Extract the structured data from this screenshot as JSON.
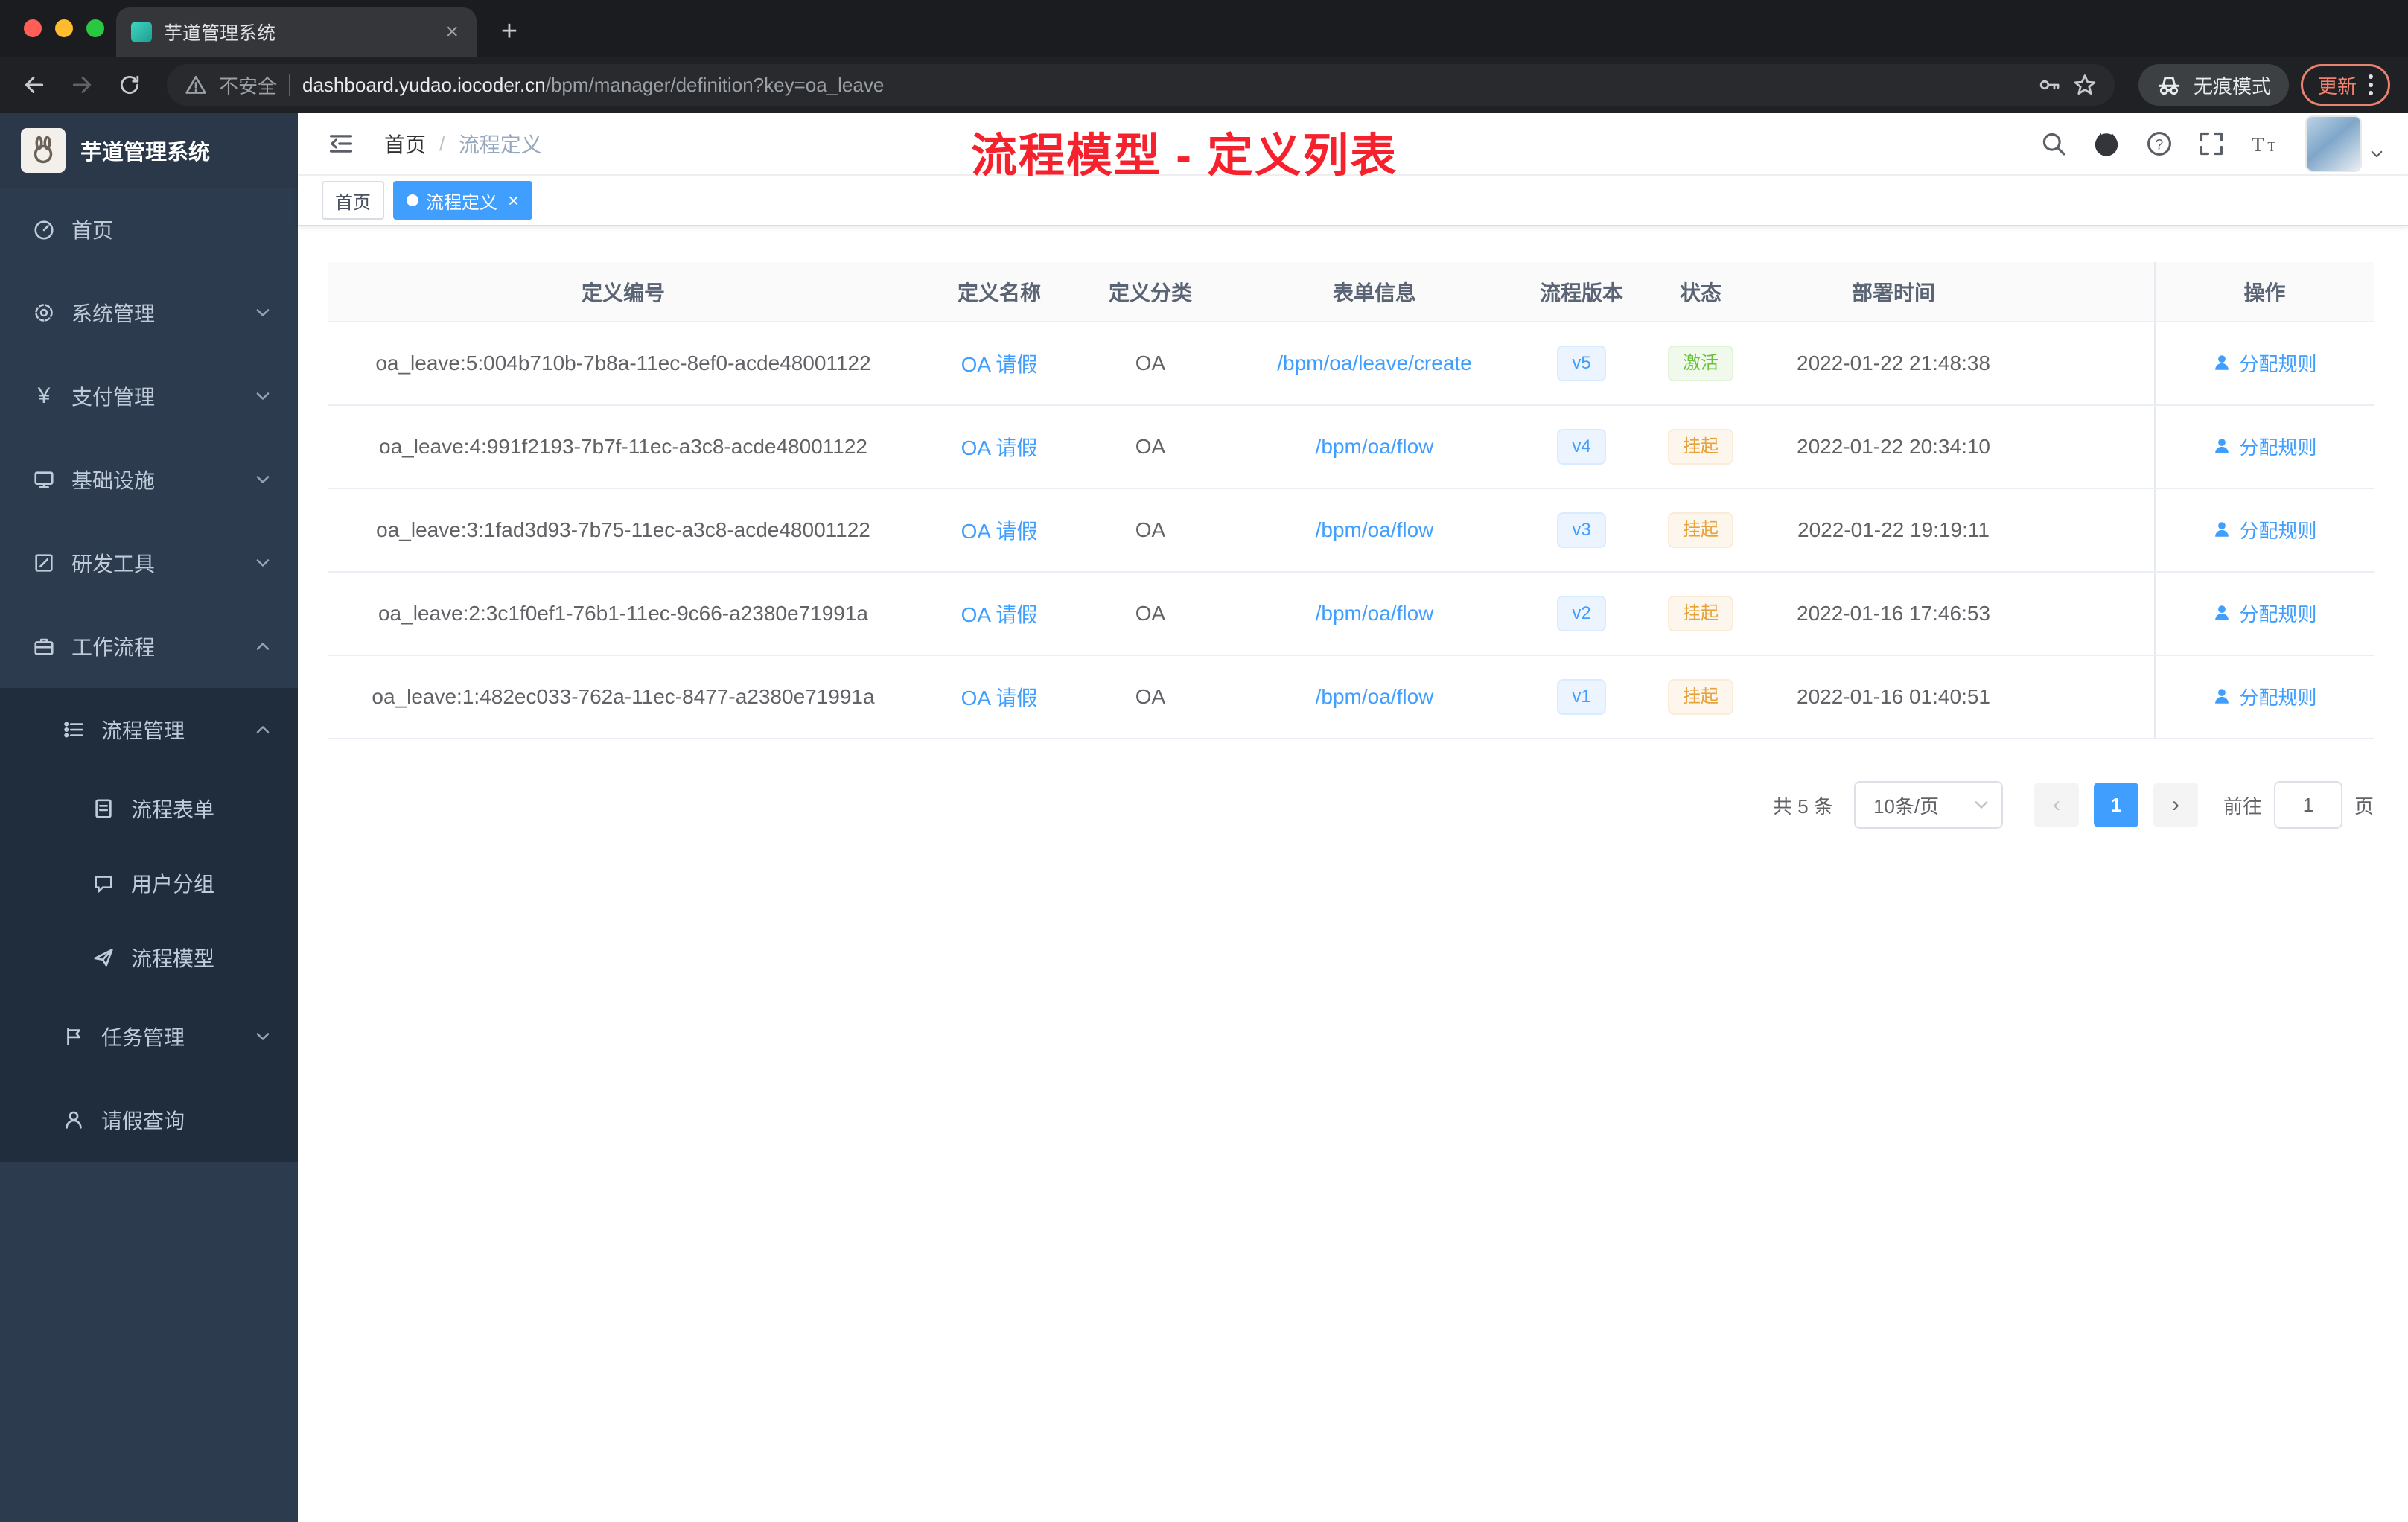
{
  "browser": {
    "tab_title": "芋道管理系统",
    "close_glyph": "×",
    "new_tab_glyph": "+",
    "security_label": "不安全",
    "url_domain": "dashboard.yudao.iocoder.cn",
    "url_path": "/bpm/manager/definition?key=oa_leave",
    "incognito_label": "无痕模式",
    "update_label": "更新"
  },
  "sidebar": {
    "logo_title": "芋道管理系统",
    "items": [
      {
        "label": "首页"
      },
      {
        "label": "系统管理"
      },
      {
        "label": "支付管理",
        "glyph": "¥"
      },
      {
        "label": "基础设施"
      },
      {
        "label": "研发工具"
      },
      {
        "label": "工作流程"
      }
    ],
    "workflow": {
      "process_mgmt": {
        "label": "流程管理"
      },
      "process_children": [
        {
          "label": "流程表单"
        },
        {
          "label": "用户分组"
        },
        {
          "label": "流程模型"
        }
      ],
      "task_mgmt": {
        "label": "任务管理"
      },
      "leave_query": {
        "label": "请假查询"
      }
    }
  },
  "header": {
    "breadcrumb": {
      "home": "首页",
      "separator": "/",
      "current": "流程定义"
    },
    "annotation": "流程模型 - 定义列表"
  },
  "tags": {
    "home": "首页",
    "active": "流程定义",
    "close_glyph": "×"
  },
  "table": {
    "columns": [
      "定义编号",
      "定义名称",
      "定义分类",
      "表单信息",
      "流程版本",
      "状态",
      "部署时间",
      "操作"
    ],
    "action_label": "分配规则",
    "rows": [
      {
        "id": "oa_leave:5:004b710b-7b8a-11ec-8ef0-acde48001122",
        "name": "OA 请假",
        "category": "OA",
        "form": "/bpm/oa/leave/create",
        "version": "v5",
        "status": "激活",
        "status_type": "success",
        "deployed_at": "2022-01-22 21:48:38"
      },
      {
        "id": "oa_leave:4:991f2193-7b7f-11ec-a3c8-acde48001122",
        "name": "OA 请假",
        "category": "OA",
        "form": "/bpm/oa/flow",
        "version": "v4",
        "status": "挂起",
        "status_type": "warning",
        "deployed_at": "2022-01-22 20:34:10"
      },
      {
        "id": "oa_leave:3:1fad3d93-7b75-11ec-a3c8-acde48001122",
        "name": "OA 请假",
        "category": "OA",
        "form": "/bpm/oa/flow",
        "version": "v3",
        "status": "挂起",
        "status_type": "warning",
        "deployed_at": "2022-01-22 19:19:11"
      },
      {
        "id": "oa_leave:2:3c1f0ef1-76b1-11ec-9c66-a2380e71991a",
        "name": "OA 请假",
        "category": "OA",
        "form": "/bpm/oa/flow",
        "version": "v2",
        "status": "挂起",
        "status_type": "warning",
        "deployed_at": "2022-01-16 17:46:53"
      },
      {
        "id": "oa_leave:1:482ec033-762a-11ec-8477-a2380e71991a",
        "name": "OA 请假",
        "category": "OA",
        "form": "/bpm/oa/flow",
        "version": "v1",
        "status": "挂起",
        "status_type": "warning",
        "deployed_at": "2022-01-16 01:40:51"
      }
    ]
  },
  "pagination": {
    "total": "共 5 条",
    "page_size": "10条/页",
    "prev_glyph": "‹",
    "page": "1",
    "next_glyph": "›",
    "goto_label": "前往",
    "goto_value": "1",
    "unit": "页"
  },
  "colors": {
    "primary": "#409eff",
    "success": "#67c23a",
    "warning": "#e6a23c",
    "annotation_red": "#f5222d"
  }
}
